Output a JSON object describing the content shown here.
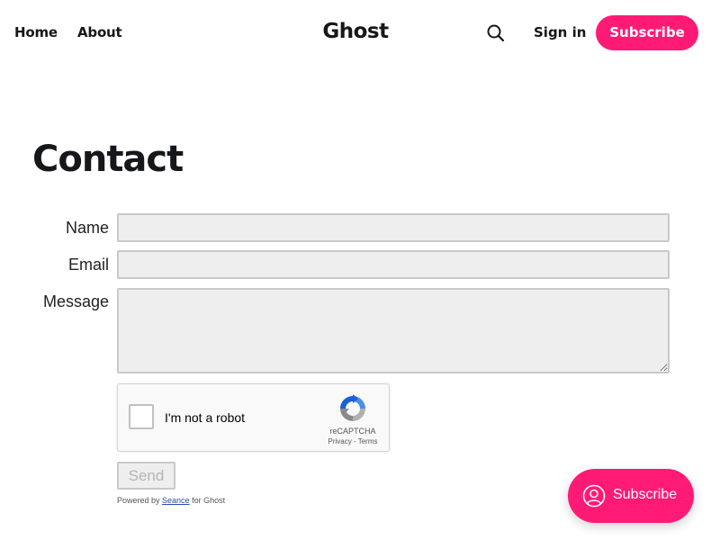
{
  "header": {
    "nav": [
      {
        "label": "Home"
      },
      {
        "label": "About"
      }
    ],
    "site_title": "Ghost",
    "search_icon": "search-icon",
    "signin_label": "Sign in",
    "subscribe_label": "Subscribe",
    "accent_color": "#ff1a75"
  },
  "page": {
    "title": "Contact"
  },
  "form": {
    "name_label": "Name",
    "email_label": "Email",
    "message_label": "Message",
    "name_value": "",
    "email_value": "",
    "message_value": "",
    "send_label": "Send"
  },
  "recaptcha": {
    "checkbox_label": "I'm not a robot",
    "brand": "reCAPTCHA",
    "privacy": "Privacy",
    "separator": " - ",
    "terms": "Terms",
    "icon": "recaptcha-logo-icon"
  },
  "footer_note": {
    "prefix": "Powered by ",
    "link": "Seance",
    "suffix": " for Ghost"
  },
  "portal": {
    "label": "Subscribe",
    "icon": "user-circle-icon"
  }
}
